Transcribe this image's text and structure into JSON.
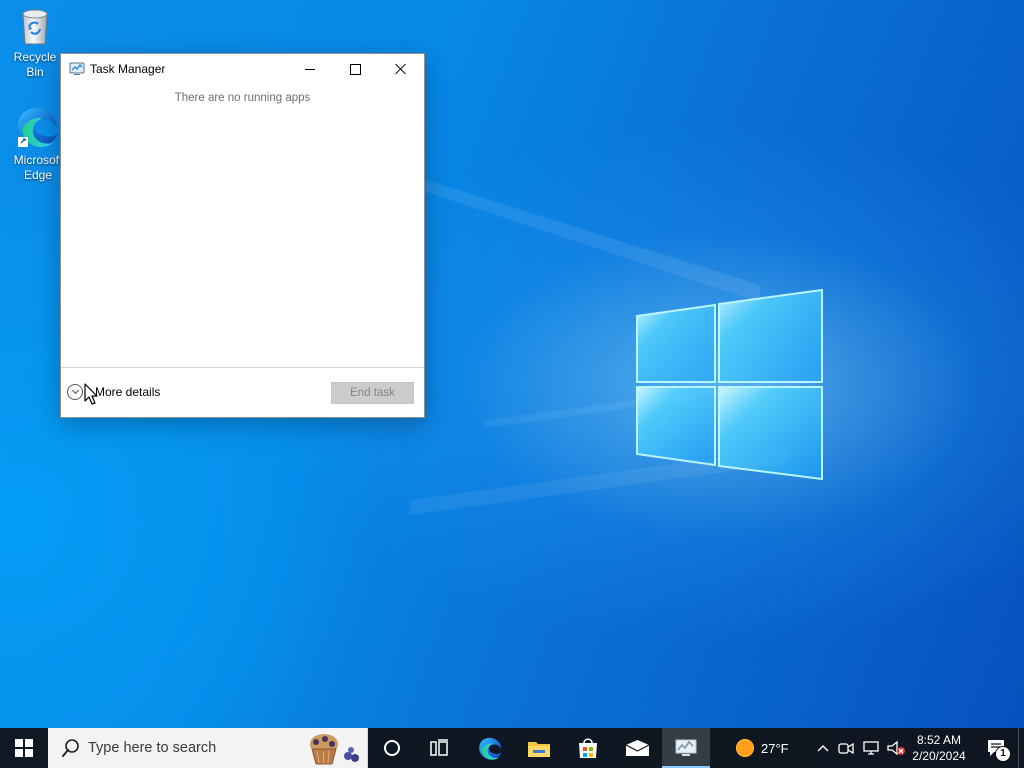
{
  "desktop": {
    "icons": [
      {
        "label": "Recycle Bin",
        "icon": "recycle-bin-icon"
      },
      {
        "label": "Microsoft Edge",
        "icon": "microsoft-edge-icon"
      }
    ]
  },
  "window": {
    "title": "Task Manager",
    "empty_message": "There are no running apps",
    "more_details_label": "More details",
    "end_task_label": "End task",
    "controls": {
      "minimize_icon": "minimize-icon",
      "maximize_icon": "maximize-icon",
      "close_icon": "close-icon"
    }
  },
  "taskbar": {
    "search_placeholder": "Type here to search",
    "apps": [
      {
        "name": "Cortana",
        "icon": "circle-icon"
      },
      {
        "name": "Task View",
        "icon": "task-view-icon"
      },
      {
        "name": "Microsoft Edge",
        "icon": "edge-icon"
      },
      {
        "name": "File Explorer",
        "icon": "folder-icon"
      },
      {
        "name": "Microsoft Store",
        "icon": "store-icon"
      },
      {
        "name": "Mail",
        "icon": "mail-icon"
      },
      {
        "name": "Task Manager",
        "icon": "task-manager-icon",
        "active": true
      }
    ],
    "weather": {
      "temperature": "27°F",
      "icon": "sun-icon"
    },
    "tray": {
      "hidden_icons": "chevron-up-icon",
      "meet_now": "meet-now-icon",
      "network": "network-icon",
      "volume": "volume-muted-icon"
    },
    "clock": {
      "time": "8:52 AM",
      "date": "2/20/2024"
    },
    "notifications": {
      "count": "1",
      "icon": "notification-icon"
    }
  },
  "colors": {
    "desktop_blue": "#078AE8",
    "taskbar": "#10141A",
    "disabled_button": "#CCCCCC",
    "sun": "#FF9F1A"
  }
}
